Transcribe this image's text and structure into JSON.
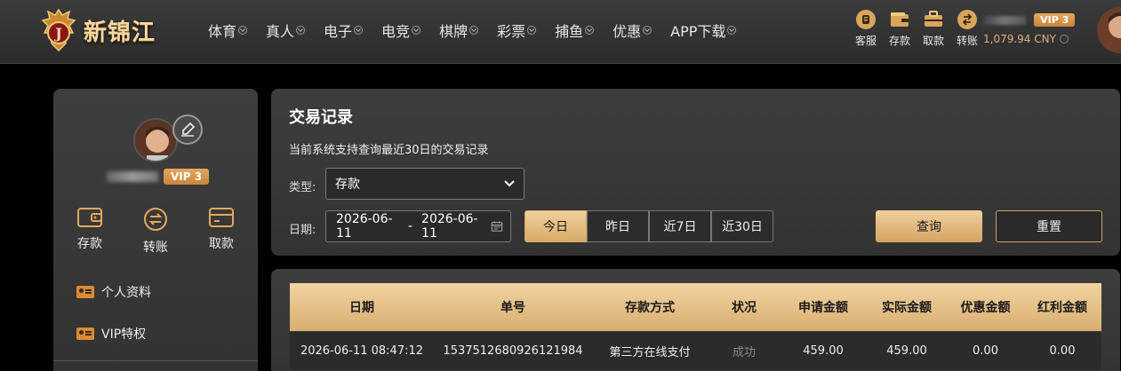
{
  "header": {
    "logo_text": "新锦江",
    "logo_letter": "J",
    "nav": [
      "体育",
      "真人",
      "电子",
      "电竞",
      "棋牌",
      "彩票",
      "捕鱼",
      "优惠",
      "APP下载"
    ],
    "tools": [
      {
        "label": "客服",
        "icon": "support-icon"
      },
      {
        "label": "存款",
        "icon": "wallet-icon"
      },
      {
        "label": "取款",
        "icon": "withdraw-icon"
      },
      {
        "label": "转账",
        "icon": "transfer-icon"
      }
    ],
    "vip": "VIP 3",
    "balance": "1,079.94 CNY"
  },
  "sidebar": {
    "vip": "VIP 3",
    "quick": [
      {
        "label": "存款",
        "icon": "wallet-icon"
      },
      {
        "label": "转账",
        "icon": "transfer-icon"
      },
      {
        "label": "取款",
        "icon": "card-icon"
      }
    ],
    "links": [
      "个人资料",
      "VIP特权"
    ]
  },
  "filter": {
    "title": "交易记录",
    "note": "当前系统支持查询最近30日的交易记录",
    "type_label": "类型:",
    "type_value": "存款",
    "date_label": "日期:",
    "date_start": "2026-06-11",
    "date_sep": "-",
    "date_end": "2026-06-11",
    "ranges": [
      "今日",
      "昨日",
      "近7日",
      "近30日"
    ],
    "query": "查询",
    "reset": "重置"
  },
  "table": {
    "columns": [
      "日期",
      "单号",
      "存款方式",
      "状况",
      "申请金额",
      "实际金额",
      "优惠金额",
      "红利金额"
    ],
    "rows": [
      [
        "2026-06-11 08:47:12",
        "1537512680926121984",
        "第三方在线支付",
        "成功",
        "459.00",
        "459.00",
        "0.00",
        "0.00"
      ]
    ]
  },
  "colors": {
    "accent": "#d9ae70",
    "vip": "#d9913f"
  }
}
